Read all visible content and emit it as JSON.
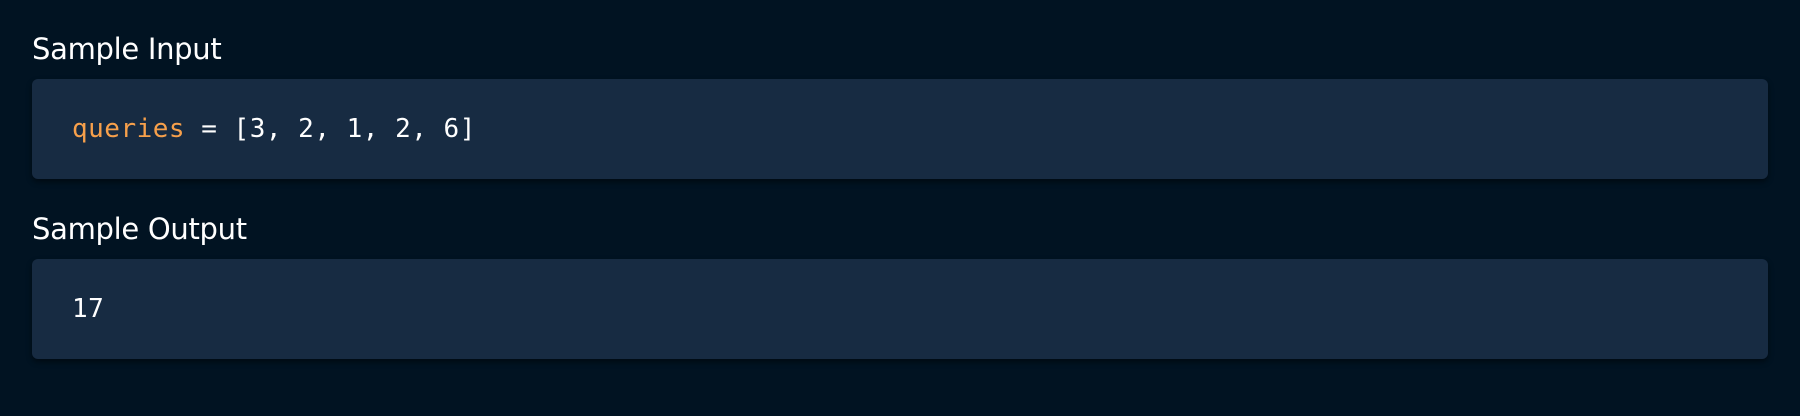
{
  "sample_input": {
    "title": "Sample Input",
    "variable": "queries",
    "operator": " = ",
    "value": "[3, 2, 1, 2, 6]"
  },
  "sample_output": {
    "title": "Sample Output",
    "value": "17"
  },
  "colors": {
    "background": "#011322",
    "code_block": "#172b42",
    "variable": "#f7a04b",
    "text": "#ffffff"
  }
}
